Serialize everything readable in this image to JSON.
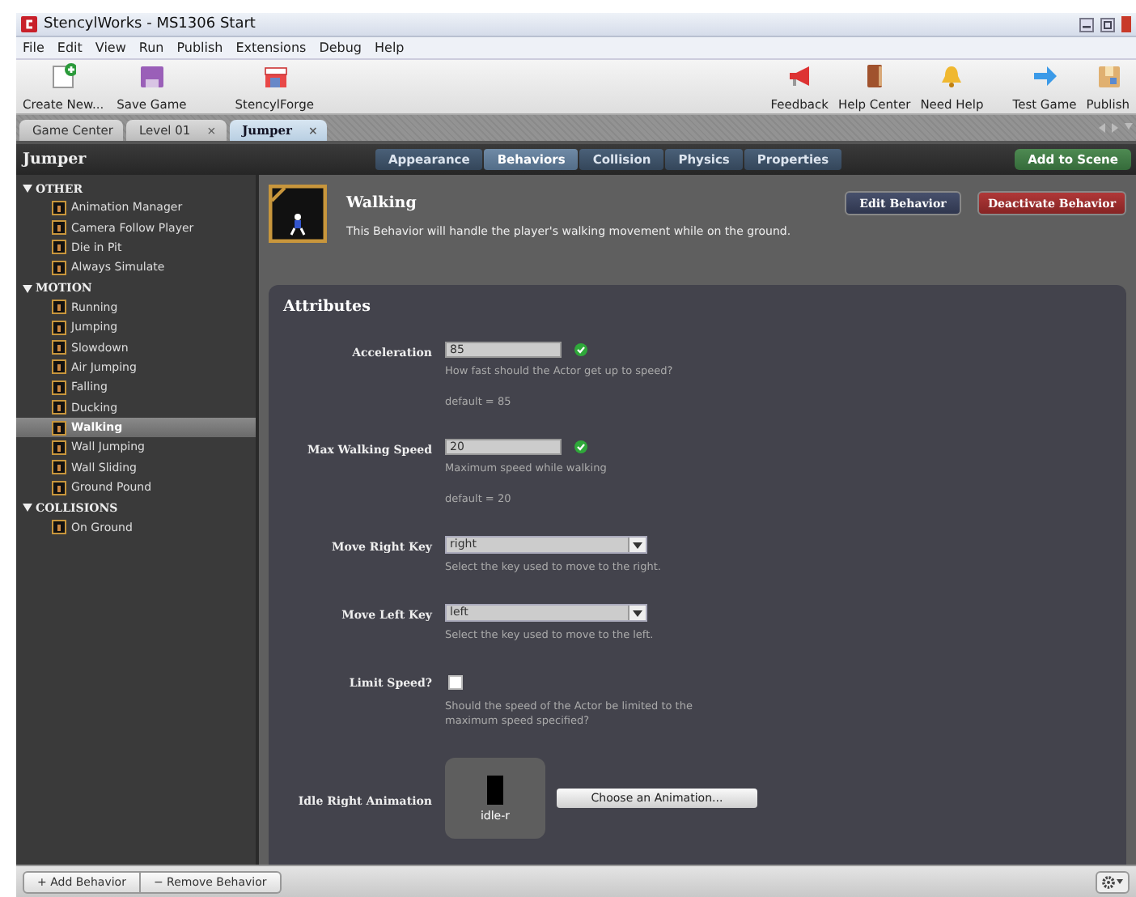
{
  "window": {
    "title": "StencylWorks - MS1306 Start"
  },
  "menu": [
    "File",
    "Edit",
    "View",
    "Run",
    "Publish",
    "Extensions",
    "Debug",
    "Help"
  ],
  "toolbar_left": [
    {
      "label": "Create New...",
      "kind": "new"
    },
    {
      "label": "Save Game",
      "kind": "save"
    },
    {
      "label": "StencylForge",
      "kind": "forge"
    }
  ],
  "toolbar_right": [
    {
      "label": "Feedback",
      "kind": "megaphone"
    },
    {
      "label": "Help Center",
      "kind": "book"
    },
    {
      "label": "Need Help",
      "kind": "bell"
    },
    {
      "label": "Test Game",
      "kind": "arrow"
    },
    {
      "label": "Publish",
      "kind": "box"
    }
  ],
  "doc_tabs": [
    {
      "label": "Game Center",
      "selected": false
    },
    {
      "label": "Level 01",
      "close": "×",
      "selected": false
    },
    {
      "label": "Jumper",
      "close": "×",
      "selected": true
    }
  ],
  "header": {
    "title": "Jumper",
    "action": "Add to Scene"
  },
  "mode_tabs": [
    {
      "label": "Appearance",
      "selected": false
    },
    {
      "label": "Behaviors",
      "selected": true
    },
    {
      "label": "Collision",
      "selected": false
    },
    {
      "label": "Physics",
      "selected": false
    },
    {
      "label": "Properties",
      "selected": false
    }
  ],
  "sidebar": {
    "groups": [
      {
        "label": "OTHER",
        "expanded": true,
        "items": [
          {
            "label": "Animation Manager",
            "selected": false
          },
          {
            "label": "Camera Follow Player",
            "selected": false
          },
          {
            "label": "Die in Pit",
            "selected": false
          },
          {
            "label": "Always Simulate",
            "selected": false
          }
        ]
      },
      {
        "label": "MOTION",
        "expanded": true,
        "items": [
          {
            "label": "Running",
            "selected": false
          },
          {
            "label": "Jumping",
            "selected": false
          },
          {
            "label": "Slowdown",
            "selected": false
          },
          {
            "label": "Air Jumping",
            "selected": false
          },
          {
            "label": "Falling",
            "selected": false
          },
          {
            "label": "Ducking",
            "selected": false
          },
          {
            "label": "Walking",
            "selected": true
          },
          {
            "label": "Wall Jumping",
            "selected": false
          },
          {
            "label": "Wall Sliding",
            "selected": false
          },
          {
            "label": "Ground Pound",
            "selected": false
          }
        ]
      },
      {
        "label": "COLLISIONS",
        "expanded": true,
        "items": [
          {
            "label": "On Ground",
            "selected": false
          }
        ]
      }
    ]
  },
  "behavior": {
    "name": "Walking",
    "description": "This Behavior will handle the player's walking movement while on the ground.",
    "edit_button": "Edit Behavior",
    "deactivate_button": "Deactivate Behavior"
  },
  "attributes": {
    "title": "Attributes",
    "items": [
      {
        "kind": "number",
        "label": "Acceleration",
        "value": "85",
        "valid": true,
        "help": "How fast should the Actor get up to speed?",
        "default": "default = 85"
      },
      {
        "kind": "number",
        "label": "Max Walking Speed",
        "value": "20",
        "valid": true,
        "help": "Maximum speed while walking",
        "default": "default = 20"
      },
      {
        "kind": "dropdown",
        "label": "Move Right Key",
        "value": "right",
        "help": "Select the key used to move to the right."
      },
      {
        "kind": "dropdown",
        "label": "Move Left Key",
        "value": "left",
        "help": "Select the key used to move to the left."
      },
      {
        "kind": "checkbox",
        "label": "Limit Speed?",
        "checked": false,
        "help": "Should the speed of the Actor be limited to the maximum speed specified?"
      },
      {
        "kind": "animation",
        "label": "Idle Right Animation",
        "animation": "idle-r",
        "button": "Choose an Animation..."
      }
    ]
  },
  "bottom_bar": {
    "buttons": [
      "+ Add Behavior",
      "− Remove Behavior"
    ]
  }
}
